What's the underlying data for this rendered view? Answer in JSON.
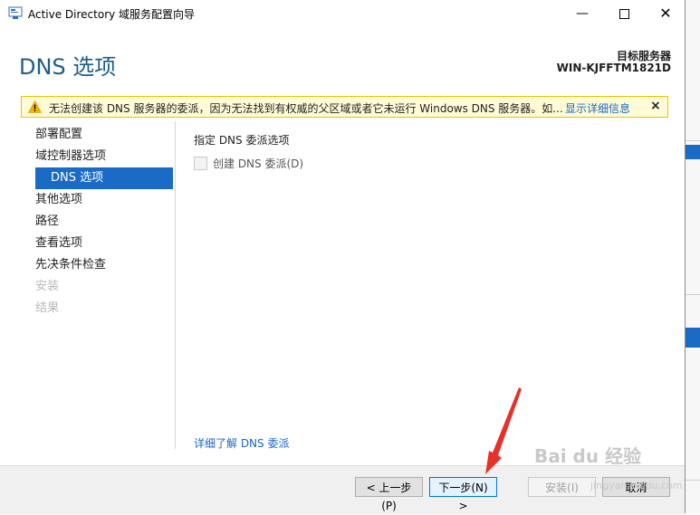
{
  "window": {
    "title": "Active Directory 域服务配置向导",
    "controls": {
      "minimize": "—",
      "close": "✕"
    }
  },
  "header": {
    "page_title": "DNS 选项",
    "target_label": "目标服务器",
    "target_name": "WIN-KJFFTM1821D"
  },
  "warning": {
    "message": "无法创建该 DNS 服务器的委派，因为无法找到有权威的父区域或者它未运行 Windows DNS 服务器。如...",
    "link": "显示详细信息",
    "close": "×"
  },
  "nav": {
    "items": [
      {
        "label": "部署配置",
        "state": "normal"
      },
      {
        "label": "域控制器选项",
        "state": "normal"
      },
      {
        "label": "DNS 选项",
        "state": "active"
      },
      {
        "label": "其他选项",
        "state": "normal"
      },
      {
        "label": "路径",
        "state": "normal"
      },
      {
        "label": "查看选项",
        "state": "normal"
      },
      {
        "label": "先决条件检查",
        "state": "normal"
      },
      {
        "label": "安装",
        "state": "disabled"
      },
      {
        "label": "结果",
        "state": "disabled"
      }
    ]
  },
  "content": {
    "section_label": "指定 DNS 委派选项",
    "checkbox_label": "创建 DNS 委派(D)",
    "checkbox_checked": false,
    "learn_more": "详细了解 DNS 委派"
  },
  "footer": {
    "prev": "< 上一步(P)",
    "next": "下一步(N) >",
    "install": "安装(I)",
    "cancel": "取消"
  },
  "watermark": {
    "text": "Bai du 经验",
    "sub": "jingyan.baidu.com"
  },
  "colors": {
    "accent": "#1a6bc6",
    "title": "#1f5d8c",
    "link": "#1a66c7",
    "warning_bg": "#fffbd6",
    "annotation_arrow": "#e8302a"
  }
}
